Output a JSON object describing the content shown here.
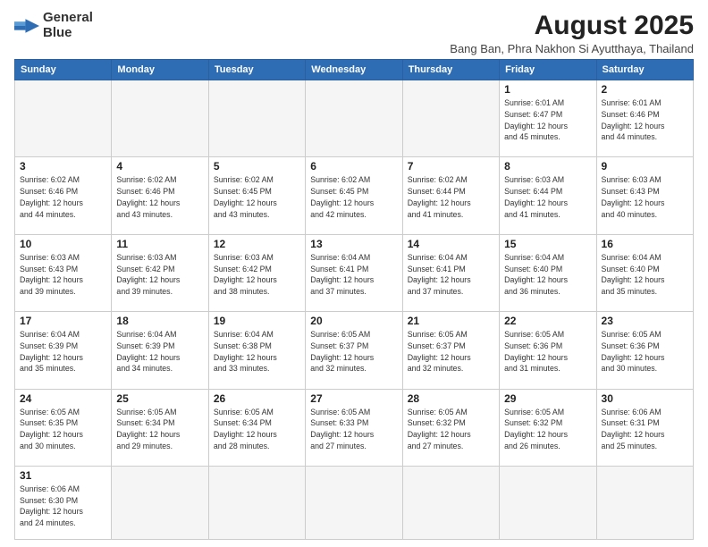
{
  "header": {
    "logo_line1": "General",
    "logo_line2": "Blue",
    "main_title": "August 2025",
    "subtitle": "Bang Ban, Phra Nakhon Si Ayutthaya, Thailand"
  },
  "weekdays": [
    "Sunday",
    "Monday",
    "Tuesday",
    "Wednesday",
    "Thursday",
    "Friday",
    "Saturday"
  ],
  "weeks": [
    [
      {
        "day": "",
        "info": ""
      },
      {
        "day": "",
        "info": ""
      },
      {
        "day": "",
        "info": ""
      },
      {
        "day": "",
        "info": ""
      },
      {
        "day": "",
        "info": ""
      },
      {
        "day": "1",
        "info": "Sunrise: 6:01 AM\nSunset: 6:47 PM\nDaylight: 12 hours\nand 45 minutes."
      },
      {
        "day": "2",
        "info": "Sunrise: 6:01 AM\nSunset: 6:46 PM\nDaylight: 12 hours\nand 44 minutes."
      }
    ],
    [
      {
        "day": "3",
        "info": "Sunrise: 6:02 AM\nSunset: 6:46 PM\nDaylight: 12 hours\nand 44 minutes."
      },
      {
        "day": "4",
        "info": "Sunrise: 6:02 AM\nSunset: 6:46 PM\nDaylight: 12 hours\nand 43 minutes."
      },
      {
        "day": "5",
        "info": "Sunrise: 6:02 AM\nSunset: 6:45 PM\nDaylight: 12 hours\nand 43 minutes."
      },
      {
        "day": "6",
        "info": "Sunrise: 6:02 AM\nSunset: 6:45 PM\nDaylight: 12 hours\nand 42 minutes."
      },
      {
        "day": "7",
        "info": "Sunrise: 6:02 AM\nSunset: 6:44 PM\nDaylight: 12 hours\nand 41 minutes."
      },
      {
        "day": "8",
        "info": "Sunrise: 6:03 AM\nSunset: 6:44 PM\nDaylight: 12 hours\nand 41 minutes."
      },
      {
        "day": "9",
        "info": "Sunrise: 6:03 AM\nSunset: 6:43 PM\nDaylight: 12 hours\nand 40 minutes."
      }
    ],
    [
      {
        "day": "10",
        "info": "Sunrise: 6:03 AM\nSunset: 6:43 PM\nDaylight: 12 hours\nand 39 minutes."
      },
      {
        "day": "11",
        "info": "Sunrise: 6:03 AM\nSunset: 6:42 PM\nDaylight: 12 hours\nand 39 minutes."
      },
      {
        "day": "12",
        "info": "Sunrise: 6:03 AM\nSunset: 6:42 PM\nDaylight: 12 hours\nand 38 minutes."
      },
      {
        "day": "13",
        "info": "Sunrise: 6:04 AM\nSunset: 6:41 PM\nDaylight: 12 hours\nand 37 minutes."
      },
      {
        "day": "14",
        "info": "Sunrise: 6:04 AM\nSunset: 6:41 PM\nDaylight: 12 hours\nand 37 minutes."
      },
      {
        "day": "15",
        "info": "Sunrise: 6:04 AM\nSunset: 6:40 PM\nDaylight: 12 hours\nand 36 minutes."
      },
      {
        "day": "16",
        "info": "Sunrise: 6:04 AM\nSunset: 6:40 PM\nDaylight: 12 hours\nand 35 minutes."
      }
    ],
    [
      {
        "day": "17",
        "info": "Sunrise: 6:04 AM\nSunset: 6:39 PM\nDaylight: 12 hours\nand 35 minutes."
      },
      {
        "day": "18",
        "info": "Sunrise: 6:04 AM\nSunset: 6:39 PM\nDaylight: 12 hours\nand 34 minutes."
      },
      {
        "day": "19",
        "info": "Sunrise: 6:04 AM\nSunset: 6:38 PM\nDaylight: 12 hours\nand 33 minutes."
      },
      {
        "day": "20",
        "info": "Sunrise: 6:05 AM\nSunset: 6:37 PM\nDaylight: 12 hours\nand 32 minutes."
      },
      {
        "day": "21",
        "info": "Sunrise: 6:05 AM\nSunset: 6:37 PM\nDaylight: 12 hours\nand 32 minutes."
      },
      {
        "day": "22",
        "info": "Sunrise: 6:05 AM\nSunset: 6:36 PM\nDaylight: 12 hours\nand 31 minutes."
      },
      {
        "day": "23",
        "info": "Sunrise: 6:05 AM\nSunset: 6:36 PM\nDaylight: 12 hours\nand 30 minutes."
      }
    ],
    [
      {
        "day": "24",
        "info": "Sunrise: 6:05 AM\nSunset: 6:35 PM\nDaylight: 12 hours\nand 30 minutes."
      },
      {
        "day": "25",
        "info": "Sunrise: 6:05 AM\nSunset: 6:34 PM\nDaylight: 12 hours\nand 29 minutes."
      },
      {
        "day": "26",
        "info": "Sunrise: 6:05 AM\nSunset: 6:34 PM\nDaylight: 12 hours\nand 28 minutes."
      },
      {
        "day": "27",
        "info": "Sunrise: 6:05 AM\nSunset: 6:33 PM\nDaylight: 12 hours\nand 27 minutes."
      },
      {
        "day": "28",
        "info": "Sunrise: 6:05 AM\nSunset: 6:32 PM\nDaylight: 12 hours\nand 27 minutes."
      },
      {
        "day": "29",
        "info": "Sunrise: 6:05 AM\nSunset: 6:32 PM\nDaylight: 12 hours\nand 26 minutes."
      },
      {
        "day": "30",
        "info": "Sunrise: 6:06 AM\nSunset: 6:31 PM\nDaylight: 12 hours\nand 25 minutes."
      }
    ],
    [
      {
        "day": "31",
        "info": "Sunrise: 6:06 AM\nSunset: 6:30 PM\nDaylight: 12 hours\nand 24 minutes."
      },
      {
        "day": "",
        "info": ""
      },
      {
        "day": "",
        "info": ""
      },
      {
        "day": "",
        "info": ""
      },
      {
        "day": "",
        "info": ""
      },
      {
        "day": "",
        "info": ""
      },
      {
        "day": "",
        "info": ""
      }
    ]
  ]
}
